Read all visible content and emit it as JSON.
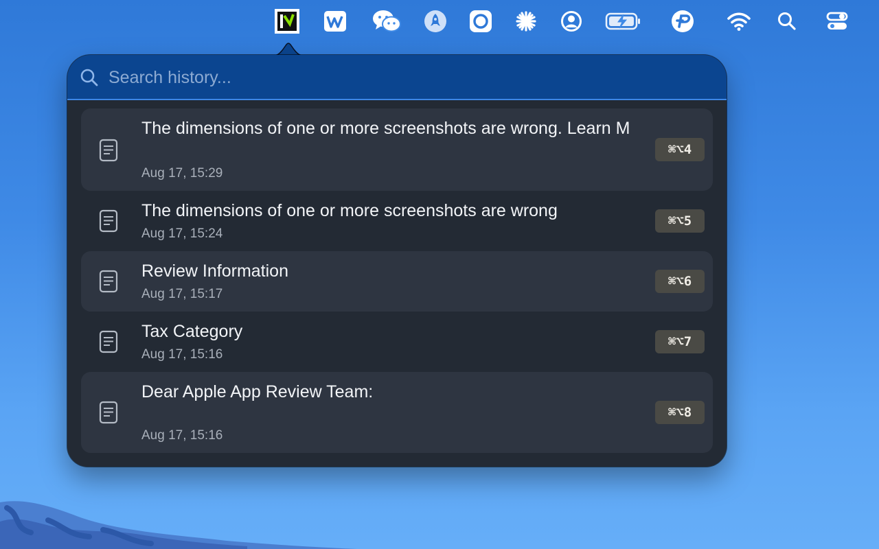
{
  "menubar": {
    "icons": [
      "pasteapp-icon",
      "wps-office-icon",
      "wechat-icon",
      "rocket-icon",
      "screenshot-icon",
      "asterisk-icon",
      "user-account-icon",
      "battery-charging-icon",
      "parallels-icon",
      "wifi-icon",
      "spotlight-search-icon",
      "control-center-icon"
    ]
  },
  "search": {
    "placeholder": "Search history...",
    "value": ""
  },
  "history": [
    {
      "title": "The dimensions of one or more screenshots are wrong. Learn M",
      "date": "Aug 17, 15:29",
      "shortcut": "⌘⌥4"
    },
    {
      "title": "The dimensions of one or more screenshots are wrong",
      "date": "Aug 17, 15:24",
      "shortcut": "⌘⌥5"
    },
    {
      "title": "Review Information",
      "date": "Aug 17, 15:17",
      "shortcut": "⌘⌥6"
    },
    {
      "title": "Tax Category",
      "date": "Aug 17, 15:16",
      "shortcut": "⌘⌥7"
    },
    {
      "title": "Dear Apple App Review Team:",
      "date": "Aug 17, 15:16",
      "shortcut": "⌘⌥8"
    }
  ],
  "colors": {
    "popover_bg": "#232a34",
    "row_highlight": "#2e3541",
    "search_bg": "#0b4590",
    "search_border": "#3d86e6",
    "shortcut_bg": "#4a4a45"
  }
}
